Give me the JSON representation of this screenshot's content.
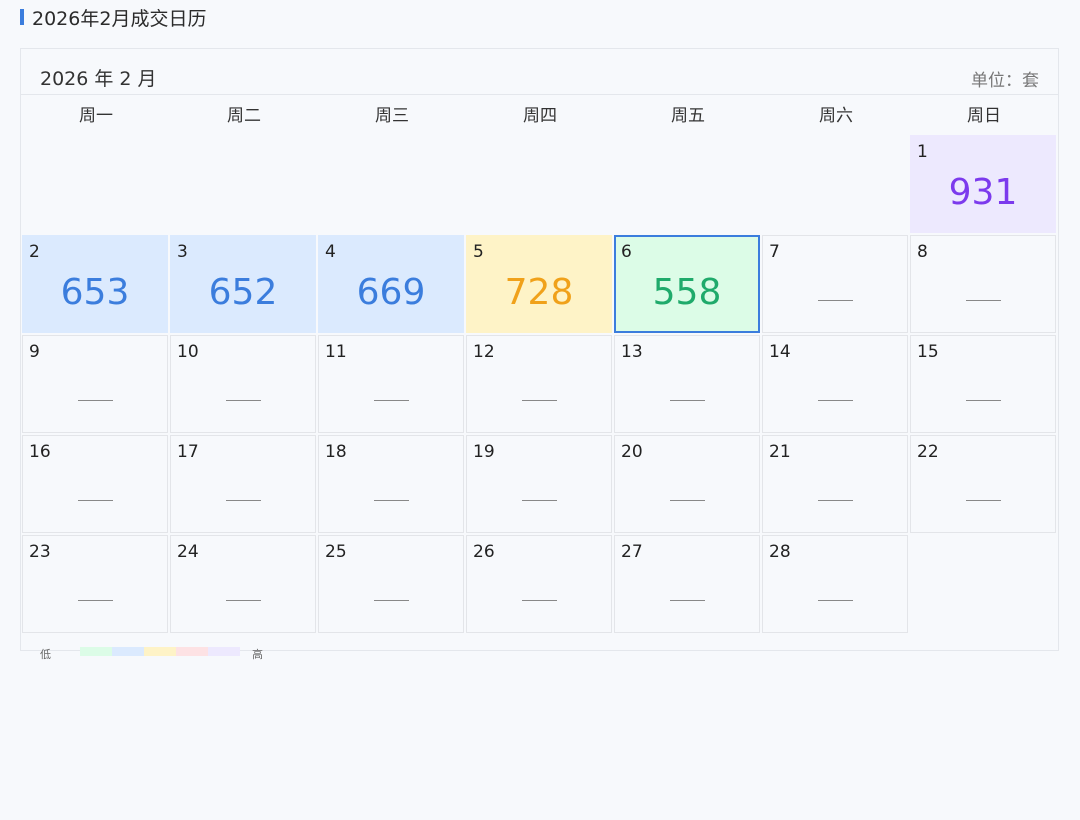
{
  "page": {
    "title": "2026年2月成交日历"
  },
  "calendar": {
    "month_label": "2026 年 2 月",
    "unit_label": "单位：套",
    "weekdays": [
      "周一",
      "周二",
      "周三",
      "周四",
      "周五",
      "周六",
      "周日"
    ],
    "empty_value": "——",
    "first_weekday_index": 6,
    "days": [
      {
        "day": "1",
        "value": "931",
        "level": "purple"
      },
      {
        "day": "2",
        "value": "653",
        "level": "blue"
      },
      {
        "day": "3",
        "value": "652",
        "level": "blue"
      },
      {
        "day": "4",
        "value": "669",
        "level": "blue"
      },
      {
        "day": "5",
        "value": "728",
        "level": "yellow"
      },
      {
        "day": "6",
        "value": "558",
        "level": "green",
        "selected": true
      },
      {
        "day": "7"
      },
      {
        "day": "8"
      },
      {
        "day": "9"
      },
      {
        "day": "10"
      },
      {
        "day": "11"
      },
      {
        "day": "12"
      },
      {
        "day": "13"
      },
      {
        "day": "14"
      },
      {
        "day": "15"
      },
      {
        "day": "16"
      },
      {
        "day": "17"
      },
      {
        "day": "18"
      },
      {
        "day": "19"
      },
      {
        "day": "20"
      },
      {
        "day": "21"
      },
      {
        "day": "22"
      },
      {
        "day": "23"
      },
      {
        "day": "24"
      },
      {
        "day": "25"
      },
      {
        "day": "26"
      },
      {
        "day": "27"
      },
      {
        "day": "28"
      }
    ],
    "levels": {
      "green": {
        "bg": "#dcfce7",
        "fg": "#1faa6b"
      },
      "blue": {
        "bg": "#dbeafe",
        "fg": "#3b7ddd"
      },
      "yellow": {
        "bg": "#fef3c7",
        "fg": "#f0a11a"
      },
      "pink": {
        "bg": "#fde2e4",
        "fg": "#e05a6a"
      },
      "purple": {
        "bg": "#ede9fe",
        "fg": "#7c3aed"
      }
    },
    "selected_border": "#3b7ddd"
  },
  "legend": {
    "low_label": "低",
    "high_label": "高",
    "colors": [
      "#dcfce7",
      "#dbeafe",
      "#fef3c7",
      "#fde2e4",
      "#ede9fe"
    ]
  }
}
